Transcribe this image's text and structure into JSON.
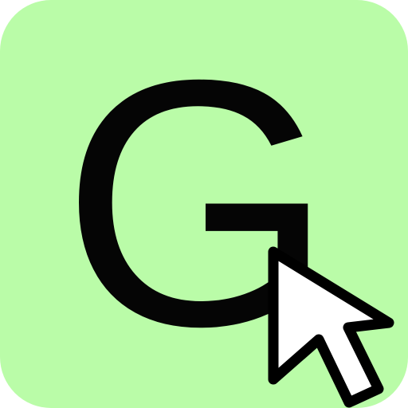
{
  "icon": {
    "letter": "G",
    "cursor_icon": "mouse-pointer-icon",
    "colors": {
      "background": "#bafca8",
      "letter": "#050505",
      "cursor_fill": "#ffffff",
      "cursor_outline": "#000000"
    }
  }
}
